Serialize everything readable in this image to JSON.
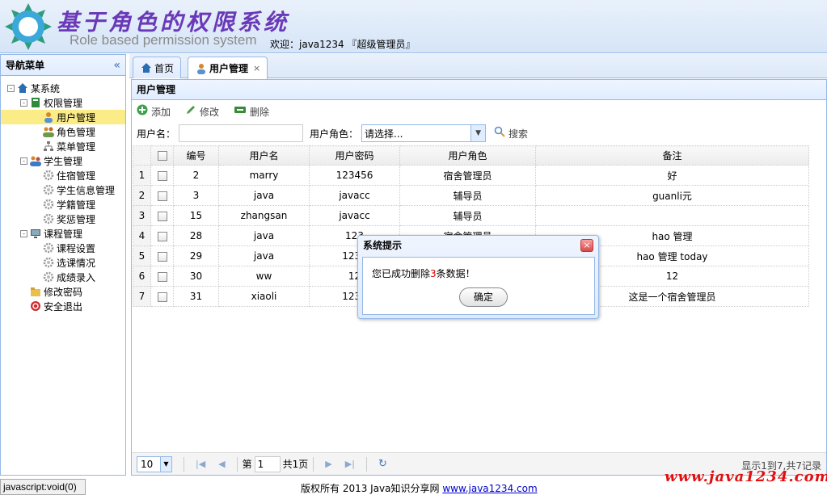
{
  "header": {
    "title_cn": "基于角色的权限系统",
    "title_en": "Role based permission system",
    "welcome": "欢迎：java1234 『超级管理员』"
  },
  "nav": {
    "title": "导航菜单",
    "collapse_icon": "«",
    "items": [
      {
        "label": "某系统",
        "icon": "home-icon",
        "level": 0,
        "toggle": "-"
      },
      {
        "label": "权限管理",
        "icon": "book-icon",
        "level": 1,
        "toggle": "-"
      },
      {
        "label": "用户管理",
        "icon": "user-icon",
        "level": 2,
        "selected": true
      },
      {
        "label": "角色管理",
        "icon": "users-icon",
        "level": 2
      },
      {
        "label": "菜单管理",
        "icon": "sitemap-icon",
        "level": 2
      },
      {
        "label": "学生管理",
        "icon": "students-icon",
        "level": 1,
        "toggle": "-"
      },
      {
        "label": "住宿管理",
        "icon": "gear-icon",
        "level": 2
      },
      {
        "label": "学生信息管理",
        "icon": "gear-icon",
        "level": 2
      },
      {
        "label": "学籍管理",
        "icon": "gear-icon",
        "level": 2
      },
      {
        "label": "奖惩管理",
        "icon": "gear-icon",
        "level": 2
      },
      {
        "label": "课程管理",
        "icon": "monitor-icon",
        "level": 1,
        "toggle": "-"
      },
      {
        "label": "课程设置",
        "icon": "gear-icon",
        "level": 2
      },
      {
        "label": "选课情况",
        "icon": "gear-icon",
        "level": 2
      },
      {
        "label": "成绩录入",
        "icon": "gear-icon",
        "level": 2
      },
      {
        "label": "修改密码",
        "icon": "folder-icon",
        "level": 1
      },
      {
        "label": "安全退出",
        "icon": "exit-icon",
        "level": 1
      }
    ]
  },
  "tabs": [
    {
      "label": "首页",
      "icon": "home-icon"
    },
    {
      "label": "用户管理",
      "icon": "user-icon",
      "closable": "×",
      "active": true
    }
  ],
  "panel": {
    "title": "用户管理",
    "toolbar": {
      "add": "添加",
      "edit": "修改",
      "delete": "删除"
    },
    "search": {
      "username_label": "用户名：",
      "username_value": "",
      "role_label": "用户角色：",
      "role_selected": "请选择...",
      "search_button": "搜索"
    },
    "columns": [
      "编号",
      "用户名",
      "用户密码",
      "用户角色",
      "备注"
    ],
    "rows": [
      {
        "rn": "1",
        "id": "2",
        "name": "marry",
        "pwd": "123456",
        "role": "宿舍管理员",
        "note": "好"
      },
      {
        "rn": "2",
        "id": "3",
        "name": "java",
        "pwd": "javacc",
        "role": "辅导员",
        "note": "guanli元"
      },
      {
        "rn": "3",
        "id": "15",
        "name": "zhangsan",
        "pwd": "javacc",
        "role": "辅导员",
        "note": ""
      },
      {
        "rn": "4",
        "id": "28",
        "name": "java",
        "pwd": "123",
        "role": "宿舍管理员",
        "note": "hao 管理"
      },
      {
        "rn": "5",
        "id": "29",
        "name": "java",
        "pwd": "1234",
        "role": "",
        "note": "hao 管理 today"
      },
      {
        "rn": "6",
        "id": "30",
        "name": "ww",
        "pwd": "12",
        "role": "",
        "note": "12"
      },
      {
        "rn": "7",
        "id": "31",
        "name": "xiaoli",
        "pwd": "1234",
        "role": "",
        "note": "这是一个宿舍管理员"
      }
    ],
    "pager": {
      "page_size": "10",
      "page_prefix": "第",
      "page_value": "1",
      "page_total": "共1页",
      "info": "显示1到7,共7记录"
    }
  },
  "dialog": {
    "title": "系统提示",
    "close": "×",
    "msg_prefix": "您已成功删除",
    "msg_count": "3",
    "msg_suffix": "条数据！",
    "ok": "确定"
  },
  "footer": {
    "status": "javascript:void(0)",
    "copyright": "版权所有 2013 Java知识分享网",
    "link": "www.java1234.com",
    "watermark": "www.java1234.com"
  },
  "colors": {
    "accent": "#95b8e7",
    "title": "#6a39b8",
    "watermark": "#e01010",
    "selected": "#fbec88"
  }
}
